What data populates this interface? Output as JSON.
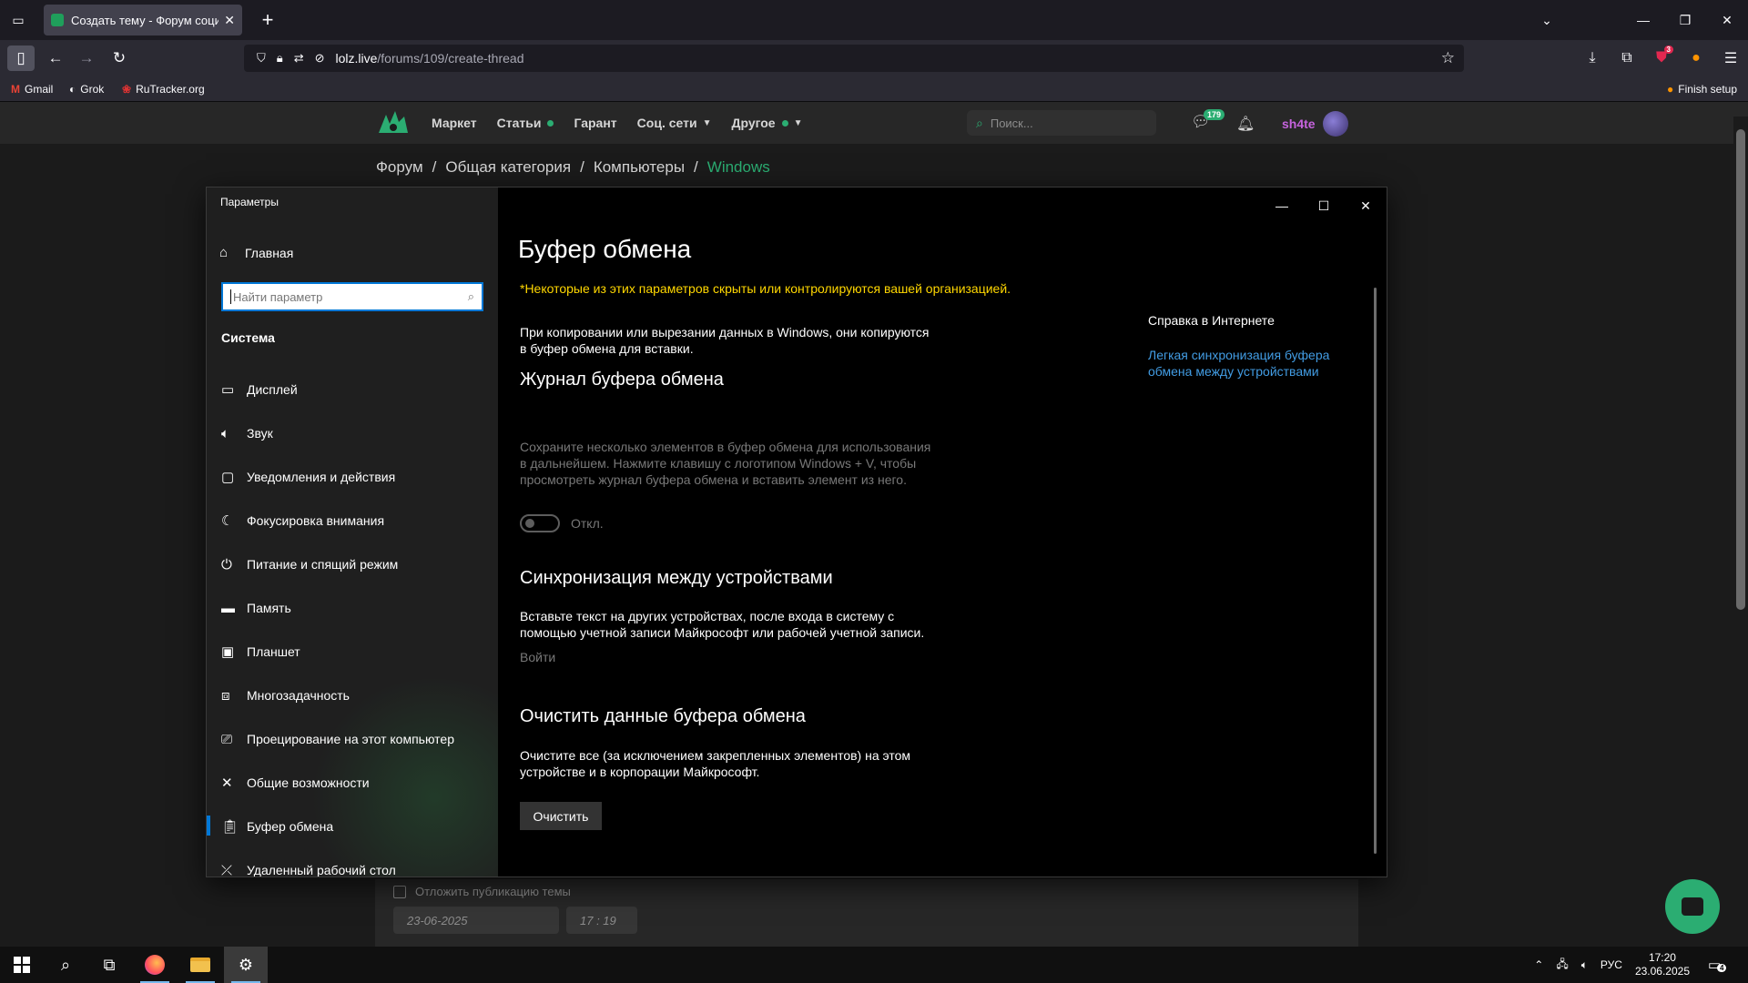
{
  "browser": {
    "tab_title": "Создать тему - Форум социал",
    "url_host": "lolz.live",
    "url_path": "/forums/109/create-thread",
    "extension_badge": "3",
    "bookmarks": [
      {
        "label": "Gmail"
      },
      {
        "label": "Grok"
      },
      {
        "label": "RuTracker.org"
      }
    ],
    "finish_setup": "Finish setup"
  },
  "site": {
    "menu": [
      {
        "label": "Маркет"
      },
      {
        "label": "Статьи"
      },
      {
        "label": "Гарант"
      },
      {
        "label": "Соц. сети"
      },
      {
        "label": "Другое"
      }
    ],
    "search_placeholder": "Поиск...",
    "messages_count": "179",
    "username": "sh4te",
    "username_color": "#c563dd",
    "accent_color": "#2bad72",
    "breadcrumb": [
      "Форум",
      "Общая категория",
      "Компьютеры",
      "Windows"
    ],
    "breadcrumb_sep": "/",
    "defer_label": "Отложить публикацию темы",
    "date_value": "23-06-2025",
    "time_value": "17 : 19"
  },
  "settings": {
    "window_title": "Параметры",
    "home_label": "Главная",
    "search_placeholder": "Найти параметр",
    "section_title": "Система",
    "nav_items": [
      {
        "label": "Дисплей"
      },
      {
        "label": "Звук"
      },
      {
        "label": "Уведомления и действия"
      },
      {
        "label": "Фокусировка внимания"
      },
      {
        "label": "Питание и спящий режим"
      },
      {
        "label": "Память"
      },
      {
        "label": "Планшет"
      },
      {
        "label": "Многозадачность"
      },
      {
        "label": "Проецирование на этот компьютер"
      },
      {
        "label": "Общие возможности"
      },
      {
        "label": "Буфер обмена"
      },
      {
        "label": "Удаленный рабочий стол"
      }
    ],
    "active_item": "Буфер обмена",
    "page_title": "Буфер обмена",
    "org_note": "*Некоторые из этих параметров скрыты или контролируются вашей организацией.",
    "intro_text": "При копировании или вырезании данных в Windows, они копируются в буфер обмена для вставки.",
    "history_title": "Журнал буфера обмена",
    "history_text": "Сохраните несколько элементов в буфер обмена для использования в дальнейшем. Нажмите клавишу с логотипом Windows + V, чтобы просмотреть журнал буфера обмена и вставить элемент из него.",
    "history_toggle_state": "Откл.",
    "sync_title": "Синхронизация между устройствами",
    "sync_text": "Вставьте текст на других устройствах, после входа в систему с помощью учетной записи Майкрософт или рабочей учетной записи.",
    "sync_signin": "Войти",
    "clear_title": "Очистить данные буфера обмена",
    "clear_text": "Очистите все (за исключением закрепленных элементов) на этом устройстве и в корпорации Майкрософт.",
    "clear_button": "Очистить",
    "help_title": "Справка в Интернете",
    "help_link": "Легкая синхронизация буфера обмена между устройствами",
    "link_color": "#429ce3",
    "warning_color": "#ffd700"
  },
  "taskbar": {
    "language": "РУС",
    "time": "17:20",
    "date": "23.06.2025",
    "notifications": "4"
  }
}
